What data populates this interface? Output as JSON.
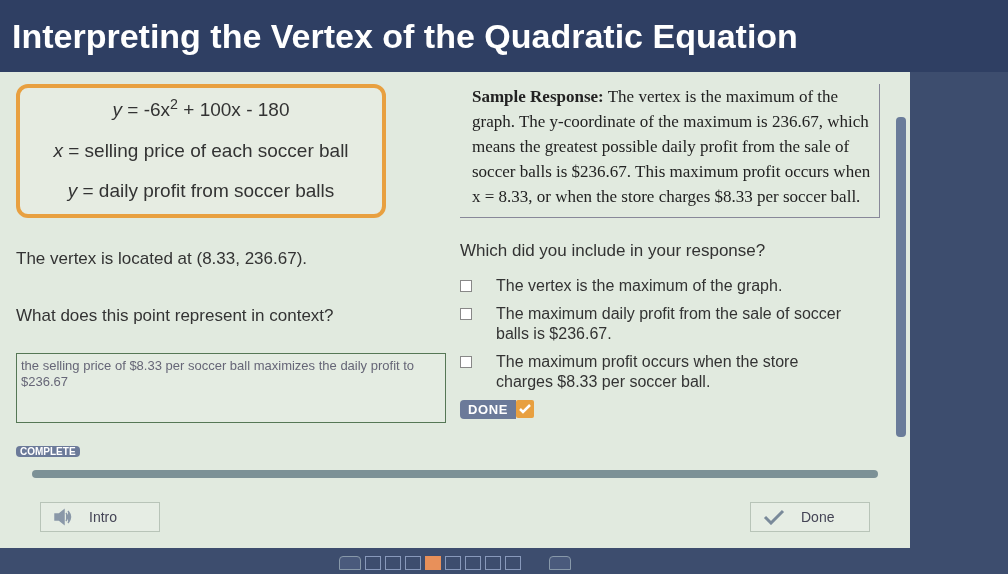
{
  "title": "Interpreting the Vertex of the Quadratic Equation",
  "definitions": [
    "*y* = -6x$^{2}$ + 100x - 180",
    "*x* = selling price of each soccer ball",
    "*y* = daily profit from soccer balls"
  ],
  "vertex_statement": "The vertex is located at (8.33, 236.67).",
  "question": "What does this point represent in context?",
  "answer": {
    "value": "the selling price of $8.33 per soccer ball maximizes the daily profit to $236.67"
  },
  "status_badge": "COMPLETE",
  "sample_response": "**Sample Response:** The vertex is the maximum of the graph. The y-coordinate of the maximum is 236.67, which means the greatest possible daily profit from the sale of soccer balls is $236.67. This maximum profit occurs when x = 8.33, or when the store charges $8.33 per soccer ball.",
  "checklist_prompt": "Which did you include in your response?",
  "checklist": [
    {
      "label": "The vertex is the maximum of the graph.",
      "checked": false
    },
    {
      "label": "The maximum daily profit from the sale of soccer balls is $236.67.",
      "checked": false
    },
    {
      "label": "The maximum profit occurs when the store charges $8.33 per soccer ball.",
      "checked": false
    }
  ],
  "done_badge": "DONE",
  "footer_buttons": [
    {
      "kind": "audio",
      "label": "Intro"
    },
    {
      "kind": "check",
      "label": "Done"
    }
  ],
  "pages": [
    {
      "selected": false
    },
    {
      "selected": false
    },
    {
      "selected": false
    },
    {
      "selected": true
    },
    {
      "selected": false
    },
    {
      "selected": false
    },
    {
      "selected": false
    },
    {
      "selected": false
    }
  ]
}
